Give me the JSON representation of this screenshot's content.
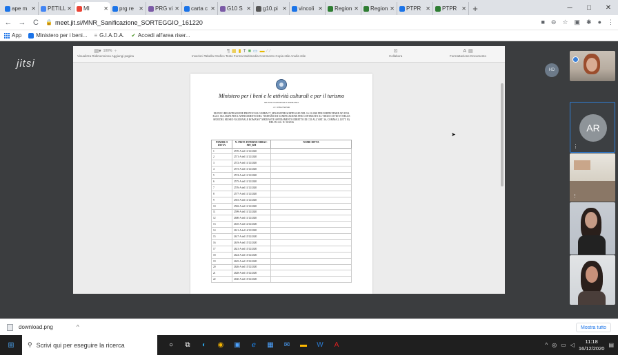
{
  "browser": {
    "tabs": [
      {
        "label": "ape m",
        "fav": "#1a73e8",
        "active": false
      },
      {
        "label": "PETILL",
        "fav": "#4285f4",
        "active": false
      },
      {
        "label": "MI",
        "fav": "#ea4335",
        "active": true
      },
      {
        "label": "prg re",
        "fav": "#1a73e8",
        "active": false
      },
      {
        "label": "PRG vi",
        "fav": "#7b5aa6",
        "active": false
      },
      {
        "label": "carta c",
        "fav": "#1a73e8",
        "active": false
      },
      {
        "label": "G10 S",
        "fav": "#7b5aa6",
        "active": false
      },
      {
        "label": "g10.pi",
        "fav": "#555555",
        "active": false
      },
      {
        "label": "vincoli",
        "fav": "#1a73e8",
        "active": false
      },
      {
        "label": "Region",
        "fav": "#2e7d32",
        "active": false
      },
      {
        "label": "Region",
        "fav": "#2e7d32",
        "active": false
      },
      {
        "label": "PTPR",
        "fav": "#1a73e8",
        "active": false
      },
      {
        "label": "PTPR",
        "fav": "#2e7d32",
        "active": false
      }
    ],
    "url": "meet.jit.si/MNR_Sanificazione_SORTEGGIO_161220",
    "bookmarks": [
      {
        "label": "App"
      },
      {
        "label": "Ministero per i beni..."
      },
      {
        "label": "G.I.A.D.A."
      },
      {
        "label": "Accedi all'area riser..."
      }
    ]
  },
  "meeting": {
    "logo": "jitsi",
    "local_initials": "HD",
    "speaker_initials": "AR"
  },
  "office_toolbar": {
    "groups": [
      {
        "label": "Visualizza  Ridimensiona  Aggiungi pagina"
      },
      {
        "label": "Inserisci  Tabella  Grafico  Testo  Forma  Multimedia  Commento  Copia stile  Anulla stile"
      },
      {
        "label": "Collabora"
      },
      {
        "label": "Formattazione  Documento"
      }
    ],
    "zoom": "100%"
  },
  "document": {
    "heading": "Ministero per i beni e le attività culturali e per il turismo",
    "museum": "MUSEO NAZIONALE ROMANO",
    "cf": "c.f. 97802790590",
    "elenco": "ELENCO REGISTRAZIONE PROTOCOLLO MIBACT_MN-RM PER SORTEGGIO DEL 16.12.2020 PER PARTECIPARE AD UNA R.d.O. SUL MePA PER L'AFFIDAMENTO DEL \"SERVIZIO DI SANIFICAZIONE PER CONTRASTO AL VIRUS COVID-19 NELLE SEDI DEL MUSEO NAZIONALE ROMANO\" MEDIANTE AFFIDAMENTO DIRETTO DI CUI ALL'ART. 36, COMMA 2, LETT. B) DEL D.LGS. N. 50/2016",
    "table": {
      "headers": [
        "NUMER O DITTA",
        "N. PROT. INTERNO MIBAC-MN_RM",
        "NOME DITTA"
      ],
      "rows": [
        {
          "n": "1",
          "prot": "2570-A del 11/12/2020"
        },
        {
          "n": "2",
          "prot": "2571-A del 11/12/2020"
        },
        {
          "n": "3",
          "prot": "2572-A del 11/12/2020"
        },
        {
          "n": "4",
          "prot": "2573-A del 11/12/2020"
        },
        {
          "n": "5",
          "prot": "2574-A del 11/12/2020"
        },
        {
          "n": "6",
          "prot": "2575-A del 11/12/2020"
        },
        {
          "n": "7",
          "prot": "2576-A del 11/12/2020"
        },
        {
          "n": "8",
          "prot": "2577-A del 11/12/2020"
        },
        {
          "n": "9",
          "prot": "2581-A del 11/12/2020"
        },
        {
          "n": "10",
          "prot": "2582-A del 11/12/2020"
        },
        {
          "n": "11",
          "prot": "2599-A del 11/12/2020"
        },
        {
          "n": "12",
          "prot": "2600-A del 11/12/2020"
        },
        {
          "n": "13",
          "prot": "2610-A del 14/12/2020"
        },
        {
          "n": "14",
          "prot": "2611-A del 14/12/2020"
        },
        {
          "n": "15",
          "prot": "2617-A del 15/12/2020"
        },
        {
          "n": "16",
          "prot": "2619-A del 15/12/2020"
        },
        {
          "n": "17",
          "prot": "2621-A del 15/12/2020"
        },
        {
          "n": "18",
          "prot": "2624-A del 15/12/2020"
        },
        {
          "n": "19",
          "prot": "2625-A del 15/12/2020"
        },
        {
          "n": "20",
          "prot": "2626-A del 15/12/2020"
        },
        {
          "n": "21",
          "prot": "2628-A del 15/12/2020"
        },
        {
          "n": "22",
          "prot": "2630-A del 15/12/2020"
        }
      ]
    }
  },
  "downloads": {
    "file": "download.png",
    "show_all": "Mostra tutto"
  },
  "taskbar": {
    "search_placeholder": "Scrivi qui per eseguire la ricerca",
    "time": "11:18",
    "date": "16/12/2020"
  }
}
